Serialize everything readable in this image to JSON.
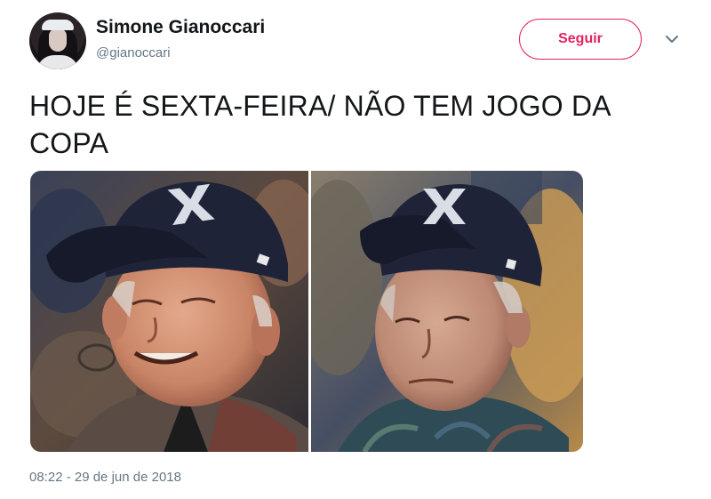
{
  "author": {
    "display_name": "Simone Gianoccari",
    "handle": "@gianoccari",
    "avatar_icon": "profile-photo-icon"
  },
  "actions": {
    "follow_label": "Seguir",
    "menu_icon": "chevron-down-icon"
  },
  "tweet": {
    "text": "HOJE É SEXTA-FEIRA/ NÃO TEM JOGO DA COPA",
    "timestamp": "08:22 - 29 de jun de 2018"
  },
  "media": {
    "photo_count": 2,
    "cap_logo_text": "X"
  },
  "colors": {
    "accent": "#e0245e",
    "text_primary": "#14171a",
    "text_secondary": "#657786",
    "cap": "#1f2337"
  }
}
